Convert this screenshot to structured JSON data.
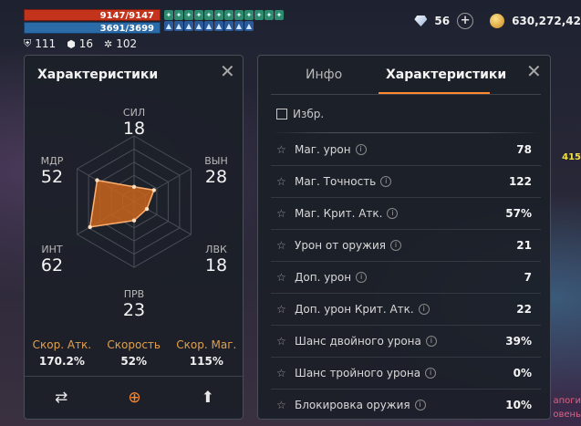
{
  "hud": {
    "hp": "9147/9147",
    "mp": "3691/3699",
    "stats": [
      {
        "icon": "shield-icon",
        "value": "111"
      },
      {
        "icon": "badge-icon",
        "value": "16"
      },
      {
        "icon": "gear-icon",
        "value": "102"
      }
    ],
    "gems": "56",
    "gold": "630,272,42",
    "side_number": "415",
    "side_text_1": "апоги",
    "side_text_2": "овень"
  },
  "left_panel": {
    "title": "Характеристики",
    "stats": {
      "str": {
        "label": "СИЛ",
        "value": 18
      },
      "vit": {
        "label": "ВЫН",
        "value": 28
      },
      "dex": {
        "label": "ЛВК",
        "value": 18
      },
      "per": {
        "label": "ПРВ",
        "value": 23
      },
      "int": {
        "label": "ИНТ",
        "value": 62
      },
      "wis": {
        "label": "МДР",
        "value": 52
      }
    },
    "speeds": [
      {
        "label": "Скор. Атк.",
        "value": "170.2%"
      },
      {
        "label": "Скорость",
        "value": "52%"
      },
      {
        "label": "Скор. Маг.",
        "value": "115%"
      }
    ],
    "buttons": [
      {
        "name": "swap-icon",
        "glyph": "⇄",
        "active": false
      },
      {
        "name": "zoom-in-icon",
        "glyph": "⊕",
        "active": true
      },
      {
        "name": "upgrade-arrow-icon",
        "glyph": "⬆",
        "active": false
      }
    ]
  },
  "right_panel": {
    "tabs": [
      {
        "label": "Инфо",
        "active": false
      },
      {
        "label": "Характеристики",
        "active": true
      }
    ],
    "favorites_label": "Избр.",
    "rows": [
      {
        "label": "Маг. урон",
        "value": "78"
      },
      {
        "label": "Маг. Точность",
        "value": "122"
      },
      {
        "label": "Маг. Крит. Атк.",
        "value": "57%"
      },
      {
        "label": "Урон от оружия",
        "value": "21"
      },
      {
        "label": "Доп. урон",
        "value": "7"
      },
      {
        "label": "Доп. урон Крит. Атк.",
        "value": "22"
      },
      {
        "label": "Шанс двойного урона",
        "value": "39%"
      },
      {
        "label": "Шанс тройного урона",
        "value": "0%"
      },
      {
        "label": "Блокировка оружия",
        "value": "10%"
      }
    ]
  },
  "colors": {
    "accent": "#ff8a30",
    "hp": "#c4341d",
    "mp": "#2b6ca8",
    "radar_fill": "#c8641c"
  }
}
